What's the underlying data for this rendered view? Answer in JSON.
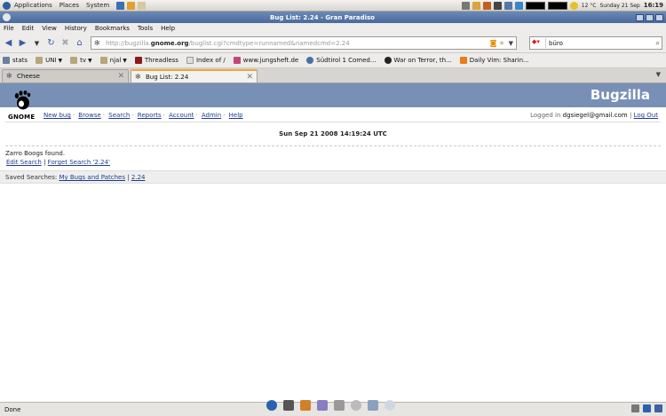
{
  "panel": {
    "menus": [
      "Applications",
      "Places",
      "System"
    ],
    "temperature": "12 °C",
    "date": "Sunday 21 Sep",
    "time": "16:19"
  },
  "window": {
    "title": "Bug List: 2.24 - Gran Paradiso"
  },
  "menubar": {
    "items": [
      "File",
      "Edit",
      "View",
      "History",
      "Bookmarks",
      "Tools",
      "Help"
    ]
  },
  "navbar": {
    "url_prefix": "http://bugzilla.",
    "url_domain": "gnome.org",
    "url_path": "/buglist.cgi?cmdtype=runnamed&namedcmd=2.24",
    "search_value": "büro"
  },
  "bookmarks": [
    {
      "label": "stats",
      "icon": "bookmark-icon",
      "folder": false
    },
    {
      "label": "UNI",
      "icon": "folder-icon",
      "folder": true
    },
    {
      "label": "tv",
      "icon": "folder-icon",
      "folder": true
    },
    {
      "label": "njal",
      "icon": "folder-icon",
      "folder": true
    },
    {
      "label": "Threadless",
      "icon": "threadless-icon",
      "folder": false
    },
    {
      "label": "Index of /",
      "icon": "page-icon",
      "folder": false
    },
    {
      "label": "www.jungsheft.de",
      "icon": "page-icon",
      "folder": false
    },
    {
      "label": "Südtirol 1 Comed...",
      "icon": "page-icon",
      "folder": false
    },
    {
      "label": "War on Terror, th...",
      "icon": "page-icon",
      "folder": false
    },
    {
      "label": "Daily Vim: Sharin...",
      "icon": "blogger-icon",
      "folder": false
    }
  ],
  "tabs": [
    {
      "label": "Cheese",
      "active": false
    },
    {
      "label": "Bug List: 2.24",
      "active": true
    }
  ],
  "page": {
    "brand": "Bugzilla",
    "logo_text": "GNOME",
    "nav_links": [
      "New bug",
      "Browse",
      "Search",
      "Reports",
      "Account",
      "Admin",
      "Help"
    ],
    "logged_in_label": "Logged in",
    "user_email": "dgsiegel@gmail.com",
    "logout": "Log Out",
    "date": "Sun Sep 21 2008 14:19:24 UTC",
    "result": "Zarro Boogs found.",
    "edit_search": "Edit Search",
    "forget_search": "Forget Search '2.24'",
    "saved_searches_label": "Saved Searches:",
    "saved_searches": [
      "My Bugs and Patches",
      "2.24"
    ]
  },
  "status": {
    "text": "Done"
  },
  "colors": {
    "bugzilla_header": "#7990b6",
    "link": "#1e3d8a",
    "active_tab_accent": "#f3a43a"
  }
}
